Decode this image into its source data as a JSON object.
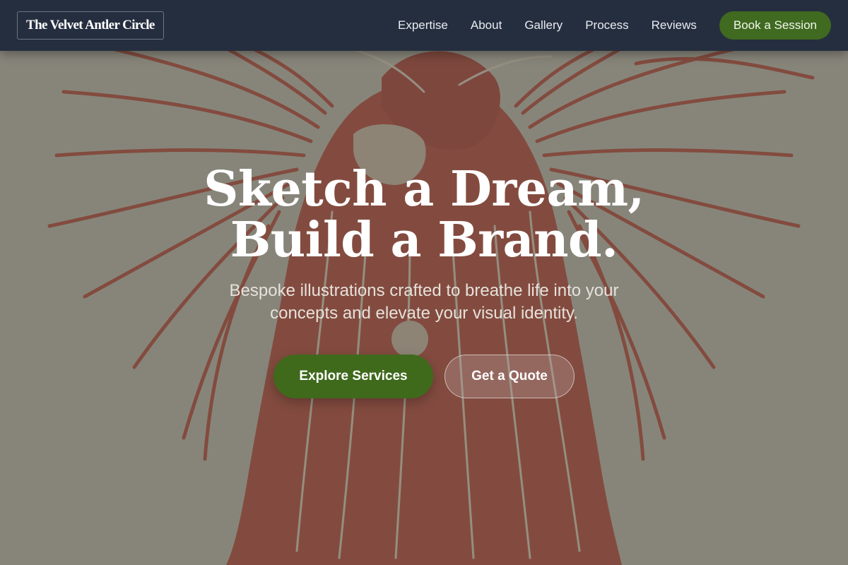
{
  "nav": {
    "logo": "The Velvet Antler Circle",
    "links": [
      "Expertise",
      "About",
      "Gallery",
      "Process",
      "Reviews"
    ],
    "cta": "Book a Session"
  },
  "hero": {
    "title_line1": "Sketch a Dream,",
    "title_line2": "Build a Brand.",
    "subtitle": "Bespoke illustrations crafted to breathe life into your concepts and elevate your visual identity.",
    "primary_button": "Explore Services",
    "secondary_button": "Get a Quote",
    "background_image": "red-ink-engraving-winged-figure"
  },
  "colors": {
    "nav_bg": "#252e3f",
    "accent_green": "#3f6a1c",
    "ink_red": "#b3402e",
    "paper": "#b9b6a8"
  }
}
